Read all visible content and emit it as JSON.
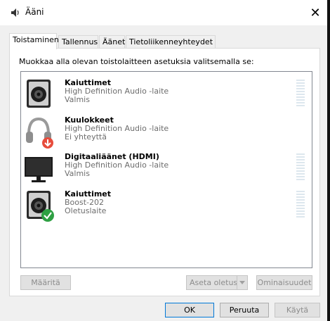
{
  "window": {
    "title": "Ääni",
    "icon": "speaker-icon",
    "close_glyph": "✕"
  },
  "tabs": [
    {
      "label": "Toistaminen",
      "active": true
    },
    {
      "label": "Tallennus",
      "active": false
    },
    {
      "label": "Äänet",
      "active": false
    },
    {
      "label": "Tietoliikenneyhteydet",
      "active": false
    }
  ],
  "instruction": "Muokkaa alla olevan toistolaitteen asetuksia valitsemalla se:",
  "devices": [
    {
      "name": "Kaiuttimet",
      "description": "High Definition Audio -laite",
      "status": "Valmis",
      "icon": "speaker-icon",
      "badge": null,
      "level_meter": true
    },
    {
      "name": "Kuulokkeet",
      "description": "High Definition Audio -laite",
      "status": "Ei yhteyttä",
      "icon": "headphones-icon",
      "badge": "disconnected-down-arrow",
      "level_meter": false
    },
    {
      "name": "Digitaaliäänet (HDMI)",
      "description": "High Definition Audio -laite",
      "status": "Valmis",
      "icon": "monitor-icon",
      "badge": null,
      "level_meter": true
    },
    {
      "name": "Kaiuttimet",
      "description": "Boost-202",
      "status": "Oletuslaite",
      "icon": "speaker-icon",
      "badge": "default-check",
      "level_meter": true
    }
  ],
  "buttons": {
    "configure": "Määritä",
    "set_default": "Aseta oletus",
    "properties": "Ominaisuudet",
    "ok": "OK",
    "cancel": "Peruuta",
    "apply": "Käytä"
  },
  "colors": {
    "accent": "#0078d7",
    "check_badge": "#2ea043",
    "down_badge": "#e74c3c",
    "meter": "#dde7ee"
  }
}
